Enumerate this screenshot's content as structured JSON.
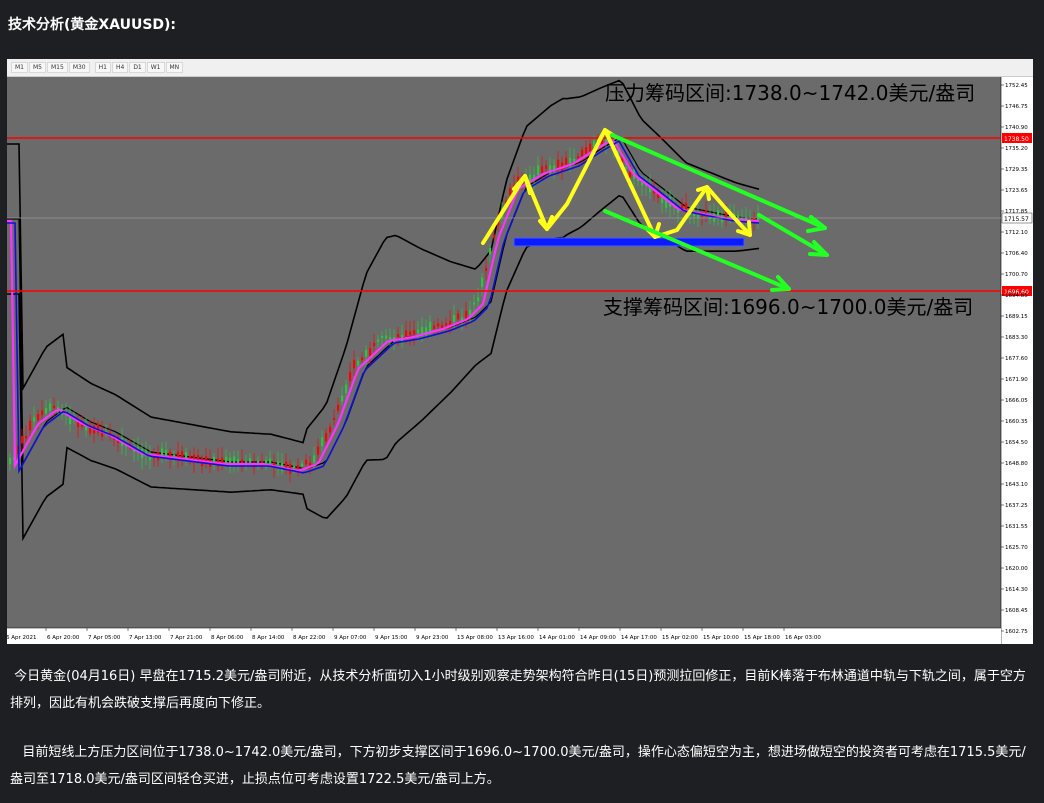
{
  "title": "技术分析(黄金XAUUSD):",
  "timeframes": [
    "M1",
    "M5",
    "M15",
    "M30",
    "H1",
    "H4",
    "D1",
    "W1",
    "MN"
  ],
  "chart": {
    "resistance_label": "压力筹码区间:1738.0~1742.0美元/盎司",
    "support_label": "支撑筹码区间:1696.0~1700.0美元/盎司",
    "resistance_line_tag": "1738.50",
    "support_line_tag": "1696.60",
    "current_price_tag": "1715.57",
    "colors": {
      "background": "#6b6b6b",
      "bull": "#27c83e",
      "bear": "#ff0000",
      "resistance": "#ff0000",
      "arrows_yellow": "#ffff1a",
      "arrows_green": "#22ff22",
      "support_box": "#0a1cff"
    },
    "y_ticks": [
      "1752.45",
      "1746.75",
      "1740.90",
      "1735.20",
      "1729.35",
      "1723.65",
      "1717.85",
      "1712.10",
      "1706.40",
      "1700.70",
      "1694.85",
      "1689.15",
      "1683.30",
      "1677.60",
      "1671.90",
      "1666.05",
      "1660.35",
      "1654.50",
      "1648.80",
      "1643.10",
      "1637.25",
      "1631.55",
      "1625.70",
      "1620.00",
      "1614.30",
      "1608.45",
      "1602.75"
    ],
    "x_ticks": [
      "6 Apr 2021",
      "6 Apr 20:00",
      "7 Apr 05:00",
      "7 Apr 13:00",
      "7 Apr 21:00",
      "8 Apr 06:00",
      "8 Apr 14:00",
      "8 Apr 22:00",
      "9 Apr 07:00",
      "9 Apr 15:00",
      "9 Apr 23:00",
      "13 Apr 08:00",
      "13 Apr 16:00",
      "14 Apr 01:00",
      "14 Apr 09:00",
      "14 Apr 17:00",
      "15 Apr 02:00",
      "15 Apr 10:00",
      "15 Apr 18:00",
      "16 Apr 03:00"
    ]
  },
  "paragraphs": [
    "今日黄金(04月16日) 早盘在1715.2美元/盎司附近，从技术分析面切入1小时级别观察走势架构符合昨日(15日)预测拉回修正，目前K棒落于布林通道中轨与下轨之间，属于空方排列，因此有机会跌破支撑后再度向下修正。",
    "目前短线上方压力区间位于1738.0~1742.0美元/盎司，下方初步支撑区间于1696.0~1700.0美元/盎司，操作心态偏短空为主，想进场做短空的投资者可考虑在1715.5美元/盎司至1718.0美元/盎司区间轻仓买进，止损点位可考虑设置1722.5美元/盎司上方。"
  ]
}
